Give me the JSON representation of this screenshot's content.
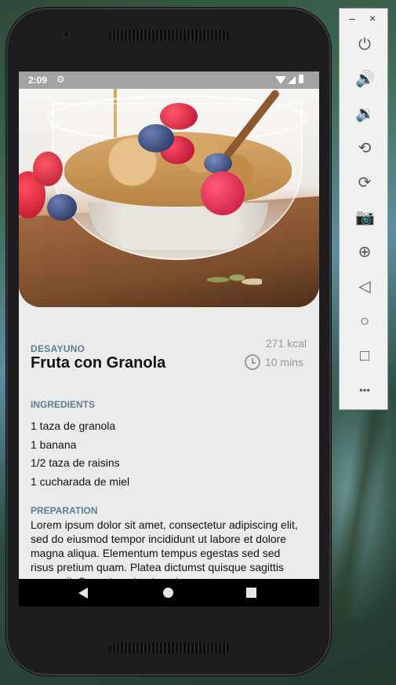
{
  "status_bar": {
    "time": "2:09",
    "settings_icon": "gear-icon"
  },
  "recipe": {
    "category": "DESAYUNO",
    "title": "Fruta con Granola",
    "calories": "271 kcal",
    "duration": "10 mins",
    "ingredients_label": "INGREDIENTS",
    "ingredients": [
      "1 taza de granola",
      "1 banana",
      "1/2 taza de raisins",
      "1 cucharada de miel"
    ],
    "preparation_label": "PREPARATION",
    "preparation": "Lorem ipsum dolor sit amet, consectetur adipiscing elit, sed do eiusmod tempor incididunt ut labore et dolore magna aliqua. Elementum tempus egestas sed sed risus pretium quam. Platea dictumst quisque sagittis purus sit. Senectus et netus et"
  },
  "emulator_panel": {
    "window_controls": {
      "minimize": "–",
      "close": "×"
    },
    "controls": [
      {
        "name": "power-icon",
        "glyph": "⏻"
      },
      {
        "name": "volume-up-icon",
        "glyph": "🔊"
      },
      {
        "name": "volume-down-icon",
        "glyph": "🔉"
      },
      {
        "name": "rotate-left-icon",
        "glyph": "⟲"
      },
      {
        "name": "rotate-right-icon",
        "glyph": "⟳"
      },
      {
        "name": "camera-icon",
        "glyph": "📷"
      },
      {
        "name": "zoom-in-icon",
        "glyph": "⊕"
      },
      {
        "name": "back-icon",
        "glyph": "◁"
      },
      {
        "name": "home-icon",
        "glyph": "○"
      },
      {
        "name": "overview-icon",
        "glyph": "□"
      },
      {
        "name": "more-icon",
        "glyph": "•••"
      }
    ]
  },
  "colors": {
    "accent_label": "#5d7d93",
    "screen_bg": "#ebebeb",
    "muted_text": "#9a9a9a"
  }
}
